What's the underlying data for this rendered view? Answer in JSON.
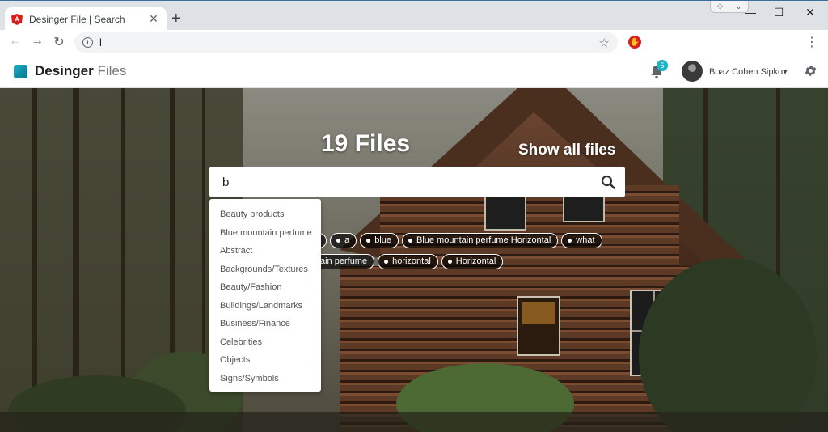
{
  "browser": {
    "tab_title": "Desinger File | Search",
    "close_glyph": "✕",
    "new_tab_glyph": "+",
    "url": "l",
    "minimize_glyph": "—",
    "maximize_glyph": "☐",
    "window_close_glyph": "✕",
    "back_glyph": "←",
    "forward_glyph": "→",
    "reload_glyph": "↻",
    "star_glyph": "☆",
    "menu_glyph": "⋮"
  },
  "header": {
    "brand_bold": "Desinger",
    "brand_light": "Files",
    "notification_count": "5",
    "user_name": "Boaz Cohen Sipko",
    "user_caret": "▾"
  },
  "hero": {
    "files_count": "19 Files",
    "show_all_label": "Show all files"
  },
  "search": {
    "value": "b"
  },
  "dropdown": {
    "items": [
      "Beauty products",
      "Blue mountain perfume",
      "Abstract",
      "Backgrounds/Textures",
      "Beauty/Fashion",
      "Buildings/Landmarks",
      "Business/Finance",
      "Celebrities",
      "Objects",
      "Signs/Symbols"
    ]
  },
  "chips": {
    "row1": [
      "a",
      "blue",
      "Blue mountain perfume Horizontal",
      "what"
    ],
    "row2": [
      "ain perfume",
      "horizontal",
      "Horizontal"
    ]
  },
  "colors": {
    "accent": "#1bb5c7",
    "adblock": "#d9201f"
  }
}
